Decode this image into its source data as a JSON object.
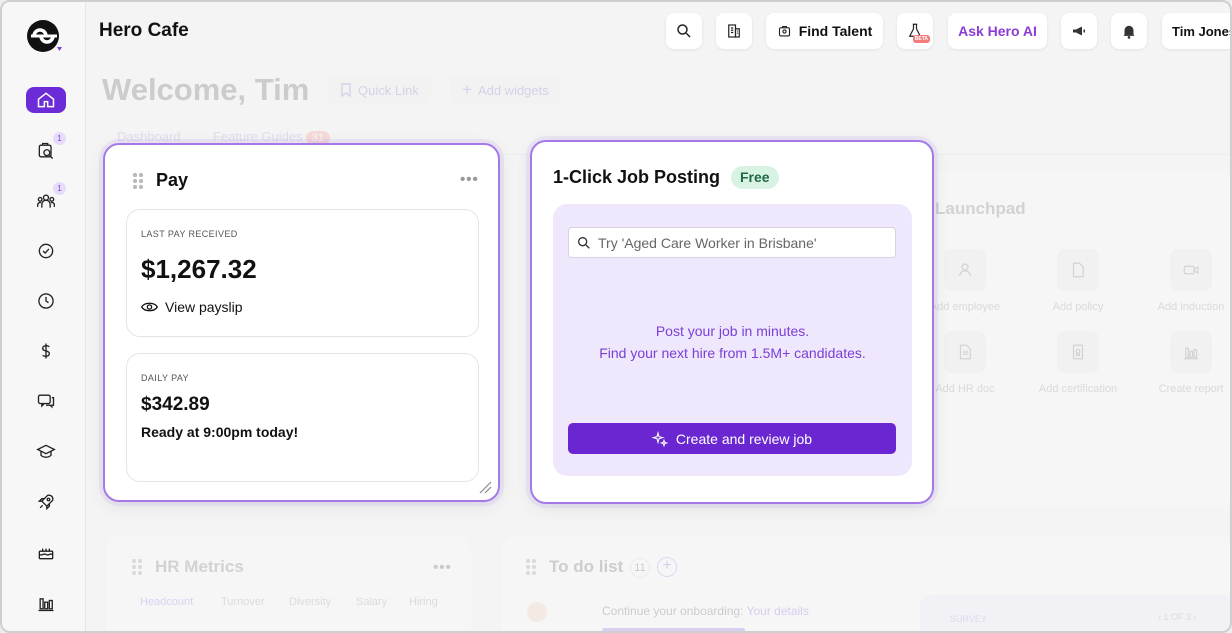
{
  "app": {
    "title": "Hero Cafe"
  },
  "topbar": {
    "find_talent": "Find Talent",
    "ask_ai": "Ask Hero AI",
    "beta": "BETA",
    "user_name": "Tim Jones",
    "icons": [
      "search-icon",
      "building-icon",
      "flask-icon",
      "megaphone-icon",
      "bell-icon"
    ]
  },
  "sidebar": {
    "items": [
      {
        "name": "home",
        "badge": ""
      },
      {
        "name": "recruit",
        "badge": "1"
      },
      {
        "name": "people",
        "badge": "1"
      },
      {
        "name": "compliance",
        "badge": ""
      },
      {
        "name": "time",
        "badge": ""
      },
      {
        "name": "payroll",
        "badge": ""
      },
      {
        "name": "messages",
        "badge": ""
      },
      {
        "name": "learning",
        "badge": ""
      },
      {
        "name": "launch",
        "badge": ""
      },
      {
        "name": "celebrations",
        "badge": ""
      },
      {
        "name": "reports",
        "badge": ""
      }
    ],
    "accent": "#6b2bd6"
  },
  "header": {
    "welcome": "Welcome, Tim",
    "quick_link": "Quick Link",
    "add_widgets": "Add widgets",
    "tabs": [
      {
        "label": "Dashboard"
      },
      {
        "label": "Feature Guides",
        "count": "31"
      }
    ]
  },
  "pay": {
    "title": "Pay",
    "last_label": "LAST PAY RECEIVED",
    "last_amount": "$1,267.32",
    "view_payslip": "View payslip",
    "daily_label": "DAILY PAY",
    "daily_amount": "$342.89",
    "ready": "Ready at 9:00pm today!"
  },
  "job": {
    "title": "1-Click Job Posting",
    "badge": "Free",
    "search_placeholder": "Try 'Aged Care Worker in Brisbane'",
    "line1": "Post your job in minutes.",
    "line2": "Find your next hire from 1.5M+ candidates.",
    "button": "Create and review job"
  },
  "launchpad": {
    "title": "Launchpad",
    "items": [
      "Add employee",
      "Add policy",
      "Add induction",
      "Add HR doc",
      "Add certification",
      "Create report"
    ]
  },
  "hr_metrics": {
    "title": "HR Metrics",
    "tabs": [
      "Headcount",
      "Turnover",
      "Diversity",
      "Salary",
      "Hiring"
    ]
  },
  "todo": {
    "title": "To do list",
    "count": "11",
    "item_text": "Continue your onboarding:",
    "item_link": "Your details",
    "survey_label": "SURVEY",
    "pager": "1 OF 3"
  },
  "colors": {
    "accent": "#6a27d1",
    "highlight_border": "#a57ae8",
    "free_badge_bg": "#d8f3e4"
  }
}
